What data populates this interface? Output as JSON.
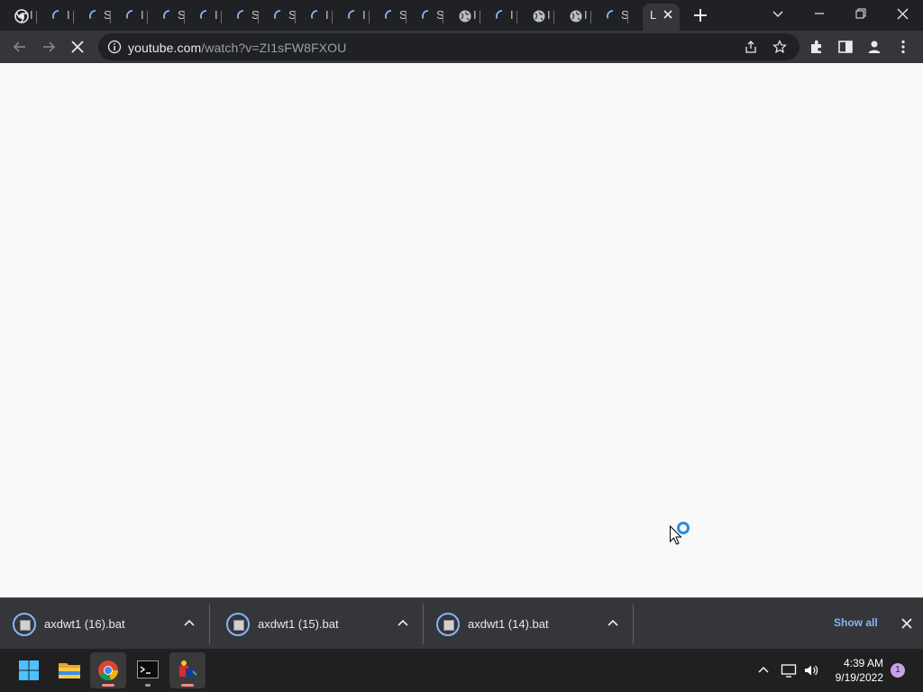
{
  "browser": {
    "tabs": [
      {
        "glyph": "I",
        "favicon": "chrome-icon"
      },
      {
        "glyph": "I",
        "favicon": "loading-spinner-icon"
      },
      {
        "glyph": "S",
        "favicon": "loading-spinner-icon"
      },
      {
        "glyph": "I",
        "favicon": "loading-spinner-icon"
      },
      {
        "glyph": "S",
        "favicon": "loading-spinner-icon"
      },
      {
        "glyph": "I",
        "favicon": "loading-spinner-icon"
      },
      {
        "glyph": "S",
        "favicon": "loading-spinner-icon"
      },
      {
        "glyph": "S",
        "favicon": "loading-spinner-icon"
      },
      {
        "glyph": "I",
        "favicon": "loading-spinner-icon"
      },
      {
        "glyph": "I",
        "favicon": "loading-spinner-icon"
      },
      {
        "glyph": "S",
        "favicon": "loading-spinner-icon"
      },
      {
        "glyph": "S",
        "favicon": "loading-spinner-icon"
      },
      {
        "glyph": "I",
        "favicon": "globe-icon"
      },
      {
        "glyph": "I",
        "favicon": "loading-spinner-icon"
      },
      {
        "glyph": "I",
        "favicon": "globe-icon"
      },
      {
        "glyph": "I",
        "favicon": "globe-icon"
      },
      {
        "glyph": "S",
        "favicon": "loading-spinner-icon"
      }
    ],
    "active_tab_glyph": "L",
    "url_host": "youtube.com",
    "url_path": "/watch?v=ZI1sFW8FXOU"
  },
  "downloads": {
    "items": [
      {
        "name": "axdwt1 (16).bat"
      },
      {
        "name": "axdwt1 (15).bat"
      },
      {
        "name": "axdwt1 (14).bat"
      }
    ],
    "show_all_label": "Show all"
  },
  "taskbar": {
    "time": "4:39 AM",
    "date": "9/19/2022",
    "notification_count": "1"
  },
  "colors": {
    "tabstrip_bg": "#202124",
    "toolbar_bg": "#35363a",
    "accent_blue": "#8ab4f8",
    "taskbar_bg": "#202020"
  }
}
